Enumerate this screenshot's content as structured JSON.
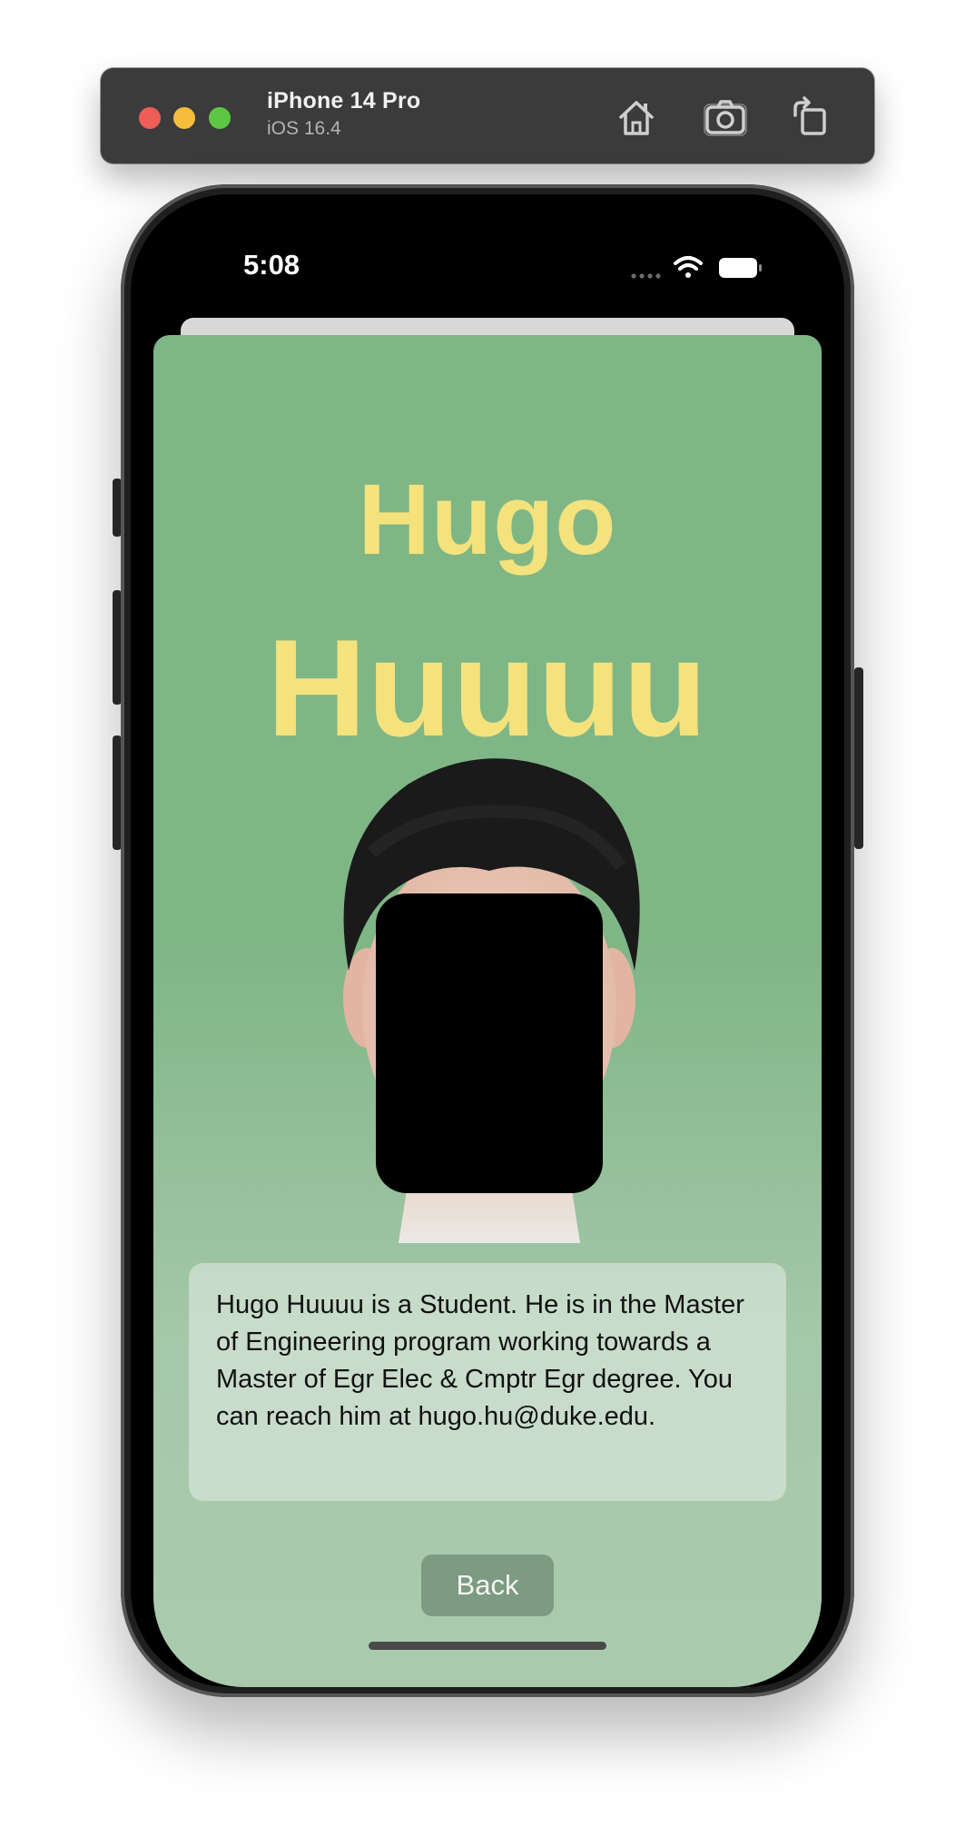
{
  "simulator": {
    "device_name": "iPhone 14 Pro",
    "os_version": "iOS 16.4",
    "toolbar_icons": [
      "home-icon",
      "screenshot-camera-icon",
      "rotate-icon"
    ]
  },
  "status_bar": {
    "time": "5:08",
    "icons": [
      "cellular-signal-icon",
      "wifi-icon",
      "battery-icon"
    ]
  },
  "profile": {
    "first_name": "Hugo",
    "last_name": "Huuuu",
    "bio": "Hugo Huuuu is a Student. He is in the Master of Engineering program working towards a Master of Egr Elec & Cmptr Egr degree. You can reach him at hugo.hu@duke.edu.",
    "back_label": "Back"
  },
  "colors": {
    "card_green": "#7fb686",
    "name_yellow": "#f4e27d",
    "back_button": "#7c9b82"
  }
}
